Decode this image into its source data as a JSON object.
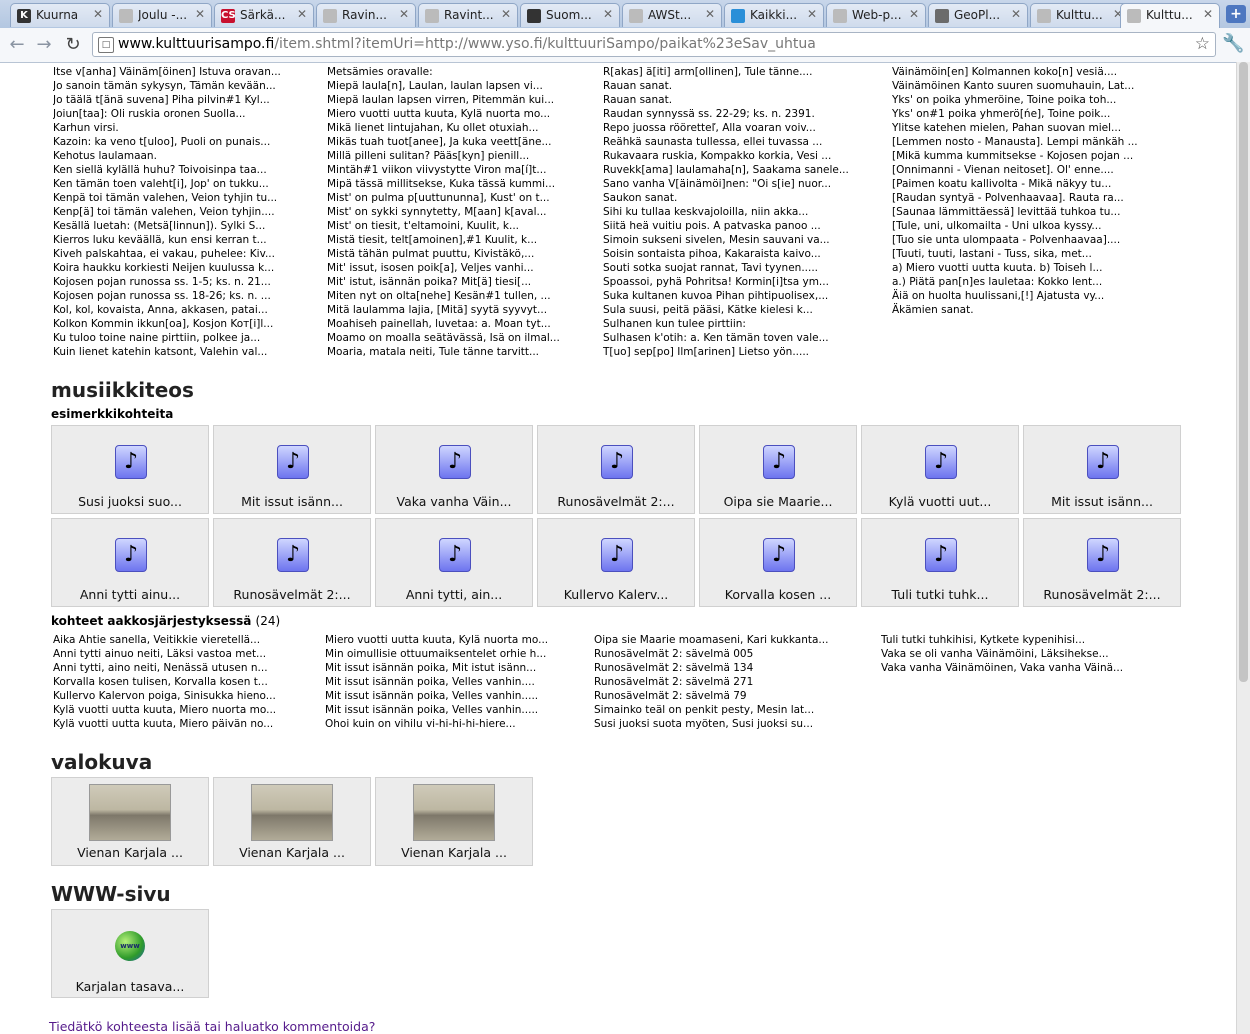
{
  "tabs": [
    {
      "label": "Kuurna",
      "icon": "k-favicon-icon",
      "favColor": "#333333",
      "favText": "K"
    },
    {
      "label": "Joulu -...",
      "icon": "document-favicon-icon",
      "favColor": "#bbbbbb",
      "favText": ""
    },
    {
      "label": "Särkä...",
      "icon": "cs-favicon-icon",
      "favColor": "#c8102e",
      "favText": "CS"
    },
    {
      "label": "Ravin...",
      "icon": "document-favicon-icon",
      "favColor": "#bbbbbb",
      "favText": ""
    },
    {
      "label": "Ravint...",
      "icon": "document-favicon-icon",
      "favColor": "#bbbbbb",
      "favText": ""
    },
    {
      "label": "Suom...",
      "icon": "github-favicon-icon",
      "favColor": "#333333",
      "favText": ""
    },
    {
      "label": "AWSt...",
      "icon": "document-favicon-icon",
      "favColor": "#bbbbbb",
      "favText": ""
    },
    {
      "label": "Kaikki...",
      "icon": "diamond-favicon-icon",
      "favColor": "#2a8fd8",
      "favText": ""
    },
    {
      "label": "Web-p...",
      "icon": "document-favicon-icon",
      "favColor": "#bbbbbb",
      "favText": ""
    },
    {
      "label": "GeoPl...",
      "icon": "puzzle-favicon-icon",
      "favColor": "#6b6b6b",
      "favText": ""
    },
    {
      "label": "Kulttu...",
      "icon": "document-favicon-icon",
      "favColor": "#bbbbbb",
      "favText": ""
    },
    {
      "label": "Kulttu...",
      "icon": "document-favicon-icon",
      "favColor": "#bbbbbb",
      "favText": "",
      "active": true
    }
  ],
  "newTabLabel": "+",
  "address": {
    "host": "www.kulttuurisampo.fi",
    "path": "/item.shtml?itemUri=http://www.yso.fi/kulttuuriSampo/paikat%23eSav_uhtua"
  },
  "topCut": [
    "Itse v[anha] Väinäm[öinen] Istuva oravan...",
    "Metsämies oravalle:",
    "R[akas] ä[iti] arm[ollinen], Tule tänne....",
    "Väinämöin[en] Kolmannen koko[n] vesiä...."
  ],
  "topColumns": [
    [
      "Itse v[anha] Väinäm[öinen] Istuva oravan...",
      "Jo sanoin tämän sykysyn, Tämän kevään...",
      "Jo täälä t[änä suvena] Piha pilvin#1 Kyl...",
      "Joiun[taa]: Oli ruskia oronen Suolla...",
      "Karhun virsi.",
      "Kazoin: ka veno t[uloo], Puoli on punais...",
      "Kehotus laulamaan.",
      "Ken siellä kylällä huhu? Toivoisinpa taa...",
      "Ken tämän toen valeht[i], Jop' on tukku...",
      "Kenpä toi tämän valehen, Veion tyhjin tu...",
      "Kenp[ä] toi tämän valehen, Veion tyhjin....",
      "Kesällä luetah: (Metsä[linnun]). Sylki S...",
      "Kierros luku keväällä, kun ensi kerran t...",
      "Kiveh palskahtaa, ei vakau, puhelee: Kiv...",
      "Koira haukku korkiesti Neijen kuulussa k...",
      "Kojosen pojan runossa ss. 1-5; ks. n. 21...",
      "Kojosen pojan runossa ss. 18-26; ks. n. ...",
      "Kol, kol, kovaista, Anna, akkasen, patai...",
      "Kolkon Kommin ikkun[oa], Kosjon Koт[i]l...",
      "Ku tuloo toine naine pirttiin, polkee ja...",
      "Kuin lienet katehin katsont, Valehin val..."
    ],
    [
      "Metsämies oravalle:",
      "Miepä laula[n], Laulan, laulan lapsen vi...",
      "Miepä laulan lapsen virren, Pitemmän kui...",
      "Miero vuotti uutta kuuta, Kylä nuorta mo...",
      "Mikä lienet lintujahan, Ku ollet otuxiah...",
      "Mikäs tuah tuot[anee], Ja kuka veett[äne...",
      "Millä pilleni sulitan? Pääs[kyn] pienill...",
      "Mintäh#1 viikon viivystytte Viron ma[í]t...",
      "Mipä tässä millitsekse, Kuka tässä kummi...",
      "Mist' on pulma p[uuttununna], Kust' on t...",
      "Mist' on sykki synnytetty, M[aan] k[aval...",
      "Mist' on tiesit, t'eltamoini, Kuulit, k...",
      "Mistä tiesit, telt[amoinen],#1 Kuulit, k...",
      "Mistä tähän pulmat puuttu, Kivistäkö,...",
      "Mit' issut, isosen poik[a], Veljes vanhi...",
      "Mit' istut, isännän poika? Mit[ä] tiesi[...",
      "Miten nyt on olta[nehe] Kesän#1 tullen, ...",
      "Mitä laulamma lajia, [Mitä] syytä syyvyt...",
      "Moahiseh painellah, luvetaa: a. Moan tyt...",
      "Moamo on moalla seätävässä, Isä on ilmal...",
      "Moaria, matala neiti, Tule tänne tarvitt..."
    ],
    [
      "R[akas] ä[iti] arm[ollinen], Tule tänne....",
      "Rauan sanat.",
      "Rauan sanat.",
      "Raudan synnyssä ss. 22-29; ks. n. 2391.",
      "Repo juossa rööretteľ, Alla voaran voiv...",
      "Reähkä saunasta tullessa, ellei tuvassa ...",
      "Rukavaara ruskia, Kompakko korkia, Vesi ...",
      "Ruvekk[ama] laulamaha[n], Saakama sanele...",
      "Sano vanha V[äinämöi]nen: \"Oi s[ie] nuor...",
      "Saukon sanat.",
      "Sihi ku tullaa keskvajoloilla, niin akka...",
      "Siitä heä vuitiu pois. A patvaska panoo ...",
      "Simoin sukseni sivelen, Mesin sauvani va...",
      "Soisin sontaista pihoa, Kakaraista kaivo...",
      "Souti sotka suojat rannat, Tavi tyynen.....",
      "Spoassoi, pyhä Pohritsa! Kormin[i]tsa ym...",
      "Suka kultanen kuvoa Pihan pihtipuolisех,...",
      "Sula suusi, peitä pääsi, Kätke kielesi k...",
      "Sulhanen kun tulee pirttiin:",
      "Sulhasen k'otih: a. Ken tämän toven vale...",
      "T[uo] sep[po] Ilm[arinen] Lietso yön....."
    ],
    [
      "Väinämöin[en] Kolmannen koko[n] vesiä....",
      "Väinämöinen Kanto suuren suomuhauin, Lat...",
      "Yks' on poika yhmeröine, Toine poika toh...",
      "Yks' on#1 poika yhmerö[ńe], Toine poik...",
      "Ylitse katehen mielen, Pahan suovan miel...",
      "[Lemmen nosto - Manausta]. Lempi mänkäh ...",
      "[Mikä kumma kummitsekse - Kojosen pojan ...",
      "[Onnimanni - Vienan neitoset]. Ol' enne....",
      "[Paimen koatu kallivolta - Mikä näkyy tu...",
      "[Raudan syntyä - Polvenhaavaa]. Rauta ra...",
      "[Saunaa lämmittäessä] levittää tuhkoa tu...",
      "[Tule, uni, ulkomailta - Uni ulkoa kyssy...",
      "[Tuo sie unta ulompaata - Polvenhaavaa]....",
      "[Tuuti, tuuti, lastani - Tuss, sika, met...",
      "a) Miero vuotti uutta kuuta. b) Toiseh l...",
      "a.) Piätä pan[n]es lauletaa: Kokko lent...",
      "Äiä on huolta huulissani,[!] Ajatusta vy...",
      "Äkämien sanat."
    ]
  ],
  "music": {
    "heading": "musiikkiteos",
    "examplesLabel": "esimerkkikohteita",
    "tiles": [
      "Susi juoksi suo...",
      "Mit issut isänn...",
      "Vaka vanha Väin...",
      "Runosävelmät 2:...",
      "Oipa sie Maarie...",
      "Kylä vuotti uut...",
      "Mit issut isänn...",
      "Anni tytti ainu...",
      "Runosävelmät 2:...",
      "Anni tytti, ain...",
      "Kullervo Kalerv...",
      "Korvalla kosen ...",
      "Tuli tutki tuhk...",
      "Runosävelmät 2:..."
    ],
    "alphaLabel": "kohteet aakkosjärjestyksessä",
    "alphaCount": "(24)",
    "alphaColumns": [
      [
        "Aika Ahtie sanella, Veitikkie vieretellä...",
        "Anni tytti ainuo neiti, Läksi vastoa met...",
        "Anni tytti, aino neiti, Nenässä utusen n...",
        "Korvalla kosen tulisen, Korvalla kosen t...",
        "Kullervo Kalervon poiga, Sinisukka hieno...",
        "Kylä vuotti uutta kuuta, Miero nuorta mo...",
        "Kylä vuotti uutta kuuta, Miero päivän no..."
      ],
      [
        "Miero vuotti uutta kuuta, Kylä nuorta mo...",
        "Min oimullisie ottuumaiksentelet orhie h...",
        "Mit issut isännän poika, Mit istut isänn...",
        "Mit issut isännän poika, Velles vanhin....",
        "Mit issut isännän poika, Velles vanhin.....",
        "Mit issut isännän poika, Velles vanhin.....",
        "Ohoi kuin on vihilu vi-hi-hi-hi-hiere..."
      ],
      [
        "Oipa sie Maarie moamaseni, Kari kukkanta...",
        "Runosävelmät 2: sävelmä 005",
        "Runosävelmät 2: sävelmä 134",
        "Runosävelmät 2: sävelmä 271",
        "Runosävelmät 2: sävelmä 79",
        "Simainko teäl on penkit pesty, Mesin lat...",
        "Susi juoksi suota myöten, Susi juoksi su..."
      ],
      [
        "Tuli tutki tuhkihisi, Kytkete kypenihisi...",
        "Vaka se oli vanha Väinämöini, Läksihekse...",
        "Vaka vanha Väinämöinen, Vaka vanha Väinä..."
      ]
    ]
  },
  "photos": {
    "heading": "valokuva",
    "tiles": [
      "Vienan Karjala ...",
      "Vienan Karjala ...",
      "Vienan Karjala ..."
    ]
  },
  "web": {
    "heading": "WWW-sivu",
    "tiles": [
      "Karjalan tasava..."
    ],
    "iconText": "www"
  },
  "commentLink": "Tiedätkö kohteesta lisää tai haluatko kommentoida?"
}
